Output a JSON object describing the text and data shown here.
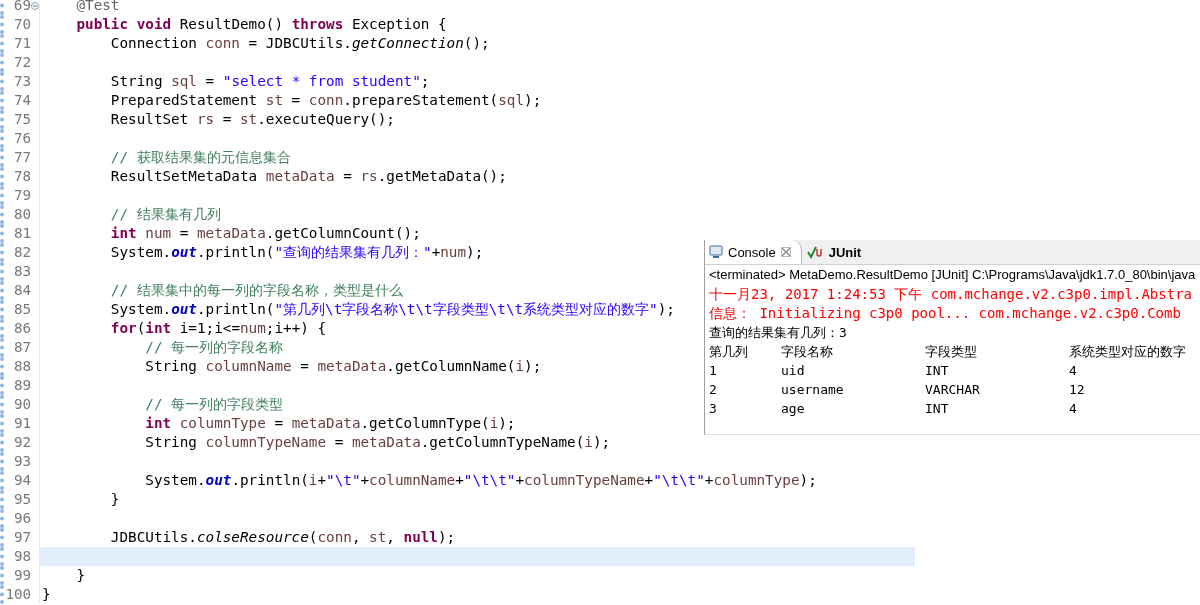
{
  "editor": {
    "lines": [
      {
        "number": "69",
        "current": false,
        "foldable": true,
        "tokens": [
          {
            "kind": "annotation",
            "text": "    @Test"
          }
        ]
      },
      {
        "number": "70",
        "current": false,
        "foldable": false,
        "tokens": [
          {
            "kind": "keyword",
            "text": "    public"
          },
          {
            "kind": "keyword",
            "text": " void"
          },
          {
            "kind": "plain",
            "text": " ResultDemo() "
          },
          {
            "kind": "keyword",
            "text": "throws"
          },
          {
            "kind": "plain",
            "text": " Exception {"
          }
        ]
      },
      {
        "number": "71",
        "current": false,
        "foldable": false,
        "tokens": [
          {
            "kind": "plain",
            "text": "        Connection "
          },
          {
            "kind": "variable",
            "text": "conn"
          },
          {
            "kind": "plain",
            "text": " = JDBCUtils."
          },
          {
            "kind": "static_method",
            "text": "getConnection"
          },
          {
            "kind": "plain",
            "text": "();"
          }
        ]
      },
      {
        "number": "72",
        "current": false,
        "foldable": false
      },
      {
        "number": "73",
        "current": false,
        "foldable": false,
        "tokens": [
          {
            "kind": "plain",
            "text": "        String "
          },
          {
            "kind": "variable",
            "text": "sql"
          },
          {
            "kind": "plain",
            "text": " = "
          },
          {
            "kind": "string",
            "text": "\"select * from student\""
          },
          {
            "kind": "plain",
            "text": ";"
          }
        ]
      },
      {
        "number": "74",
        "current": false,
        "foldable": false,
        "tokens": [
          {
            "kind": "plain",
            "text": "        PreparedStatement "
          },
          {
            "kind": "variable",
            "text": "st"
          },
          {
            "kind": "plain",
            "text": " = "
          },
          {
            "kind": "variable",
            "text": "conn"
          },
          {
            "kind": "plain",
            "text": ".prepareStatement("
          },
          {
            "kind": "variable",
            "text": "sql"
          },
          {
            "kind": "plain",
            "text": ");"
          }
        ]
      },
      {
        "number": "75",
        "current": false,
        "foldable": false,
        "tokens": [
          {
            "kind": "plain",
            "text": "        ResultSet "
          },
          {
            "kind": "variable",
            "text": "rs"
          },
          {
            "kind": "plain",
            "text": " = "
          },
          {
            "kind": "variable",
            "text": "st"
          },
          {
            "kind": "plain",
            "text": ".executeQuery();"
          }
        ]
      },
      {
        "number": "76",
        "current": false,
        "foldable": false
      },
      {
        "number": "77",
        "current": false,
        "foldable": false,
        "tokens": [
          {
            "kind": "comment",
            "text": "        // 获取结果集的元信息集合"
          }
        ]
      },
      {
        "number": "78",
        "current": false,
        "foldable": false,
        "tokens": [
          {
            "kind": "plain",
            "text": "        ResultSetMetaData "
          },
          {
            "kind": "variable",
            "text": "metaData"
          },
          {
            "kind": "plain",
            "text": " = "
          },
          {
            "kind": "variable",
            "text": "rs"
          },
          {
            "kind": "plain",
            "text": ".getMetaData();"
          }
        ]
      },
      {
        "number": "79",
        "current": false,
        "foldable": false
      },
      {
        "number": "80",
        "current": false,
        "foldable": false,
        "tokens": [
          {
            "kind": "comment",
            "text": "        // 结果集有几列"
          }
        ]
      },
      {
        "number": "81",
        "current": false,
        "foldable": false,
        "tokens": [
          {
            "kind": "keyword",
            "text": "        int"
          },
          {
            "kind": "variable",
            "text": " num"
          },
          {
            "kind": "plain",
            "text": " = "
          },
          {
            "kind": "variable",
            "text": "metaData"
          },
          {
            "kind": "plain",
            "text": ".getColumnCount();"
          }
        ]
      },
      {
        "number": "82",
        "current": false,
        "foldable": false,
        "tokens": [
          {
            "kind": "plain",
            "text": "        System."
          },
          {
            "kind": "static_field",
            "text": "out"
          },
          {
            "kind": "plain",
            "text": ".println("
          },
          {
            "kind": "string",
            "text": "\"查询的结果集有几列：\""
          },
          {
            "kind": "plain",
            "text": "+"
          },
          {
            "kind": "variable",
            "text": "num"
          },
          {
            "kind": "plain",
            "text": ");"
          }
        ]
      },
      {
        "number": "83",
        "current": false,
        "foldable": false
      },
      {
        "number": "84",
        "current": false,
        "foldable": false,
        "tokens": [
          {
            "kind": "comment",
            "text": "        // 结果集中的每一列的字段名称，类型是什么"
          }
        ]
      },
      {
        "number": "85",
        "current": false,
        "foldable": false,
        "tokens": [
          {
            "kind": "plain",
            "text": "        System."
          },
          {
            "kind": "static_field",
            "text": "out"
          },
          {
            "kind": "plain",
            "text": ".println("
          },
          {
            "kind": "string",
            "text": "\"第几列\\t字段名称\\t\\t字段类型\\t\\t系统类型对应的数字\""
          },
          {
            "kind": "plain",
            "text": ");"
          }
        ]
      },
      {
        "number": "86",
        "current": false,
        "foldable": false,
        "tokens": [
          {
            "kind": "keyword",
            "text": "        for"
          },
          {
            "kind": "plain",
            "text": "("
          },
          {
            "kind": "keyword",
            "text": "int"
          },
          {
            "kind": "plain",
            "text": " i=1;i<="
          },
          {
            "kind": "variable",
            "text": "num"
          },
          {
            "kind": "plain",
            "text": ";i++) {"
          }
        ]
      },
      {
        "number": "87",
        "current": false,
        "foldable": false,
        "tokens": [
          {
            "kind": "comment",
            "text": "            // 每一列的字段名称"
          }
        ]
      },
      {
        "number": "88",
        "current": false,
        "foldable": false,
        "tokens": [
          {
            "kind": "plain",
            "text": "            String "
          },
          {
            "kind": "variable",
            "text": "columnName"
          },
          {
            "kind": "plain",
            "text": " = "
          },
          {
            "kind": "variable",
            "text": "metaData"
          },
          {
            "kind": "plain",
            "text": ".getColumnName("
          },
          {
            "kind": "variable",
            "text": "i"
          },
          {
            "kind": "plain",
            "text": ");"
          }
        ]
      },
      {
        "number": "89",
        "current": false,
        "foldable": false
      },
      {
        "number": "90",
        "current": false,
        "foldable": false,
        "tokens": [
          {
            "kind": "comment",
            "text": "            // 每一列的字段类型"
          }
        ]
      },
      {
        "number": "91",
        "current": false,
        "foldable": false,
        "tokens": [
          {
            "kind": "keyword",
            "text": "            int"
          },
          {
            "kind": "variable",
            "text": " columnType"
          },
          {
            "kind": "plain",
            "text": " = "
          },
          {
            "kind": "variable",
            "text": "metaData"
          },
          {
            "kind": "plain",
            "text": ".getColumnType("
          },
          {
            "kind": "variable",
            "text": "i"
          },
          {
            "kind": "plain",
            "text": ");"
          }
        ]
      },
      {
        "number": "92",
        "current": false,
        "foldable": false,
        "tokens": [
          {
            "kind": "plain",
            "text": "            String "
          },
          {
            "kind": "variable",
            "text": "columnTypeName"
          },
          {
            "kind": "plain",
            "text": " = "
          },
          {
            "kind": "variable",
            "text": "metaData"
          },
          {
            "kind": "plain",
            "text": ".getColumnTypeName("
          },
          {
            "kind": "variable",
            "text": "i"
          },
          {
            "kind": "plain",
            "text": ");"
          }
        ]
      },
      {
        "number": "93",
        "current": false,
        "foldable": false
      },
      {
        "number": "94",
        "current": false,
        "foldable": false,
        "tokens": [
          {
            "kind": "plain",
            "text": "            System."
          },
          {
            "kind": "static_field",
            "text": "out"
          },
          {
            "kind": "plain",
            "text": ".println("
          },
          {
            "kind": "variable",
            "text": "i"
          },
          {
            "kind": "plain",
            "text": "+"
          },
          {
            "kind": "string",
            "text": "\"\\t\""
          },
          {
            "kind": "plain",
            "text": "+"
          },
          {
            "kind": "variable",
            "text": "columnName"
          },
          {
            "kind": "plain",
            "text": "+"
          },
          {
            "kind": "string",
            "text": "\"\\t\\t\""
          },
          {
            "kind": "plain",
            "text": "+"
          },
          {
            "kind": "variable",
            "text": "columnTypeName"
          },
          {
            "kind": "plain",
            "text": "+"
          },
          {
            "kind": "string",
            "text": "\"\\t\\t\""
          },
          {
            "kind": "plain",
            "text": "+"
          },
          {
            "kind": "variable",
            "text": "columnType"
          },
          {
            "kind": "plain",
            "text": ");"
          }
        ]
      },
      {
        "number": "95",
        "current": false,
        "foldable": false,
        "tokens": [
          {
            "kind": "plain",
            "text": "        }"
          }
        ]
      },
      {
        "number": "96",
        "current": false,
        "foldable": false
      },
      {
        "number": "97",
        "current": false,
        "foldable": false,
        "tokens": [
          {
            "kind": "plain",
            "text": "        JDBCUtils."
          },
          {
            "kind": "static_method",
            "text": "colseResource"
          },
          {
            "kind": "plain",
            "text": "("
          },
          {
            "kind": "variable",
            "text": "conn"
          },
          {
            "kind": "plain",
            "text": ", "
          },
          {
            "kind": "variable",
            "text": "st"
          },
          {
            "kind": "plain",
            "text": ", "
          },
          {
            "kind": "keyword",
            "text": "null"
          },
          {
            "kind": "plain",
            "text": ");"
          }
        ]
      },
      {
        "number": "98",
        "current": true,
        "foldable": false
      },
      {
        "number": "99",
        "current": false,
        "foldable": false,
        "tokens": [
          {
            "kind": "plain",
            "text": "    }"
          }
        ]
      },
      {
        "number": "100",
        "current": false,
        "foldable": false,
        "tokens": [
          {
            "kind": "plain",
            "text": "}"
          }
        ]
      }
    ]
  },
  "console": {
    "tabs": [
      {
        "label": "Console",
        "selected": true,
        "bold": false
      },
      {
        "label": "JUnit",
        "selected": false,
        "bold": true
      }
    ],
    "header": "<terminated> MetaDemo.ResultDemo [JUnit] C:\\Programs\\Java\\jdk1.7.0_80\\bin\\java",
    "lines": [
      {
        "kind": "error",
        "text": "十一月23, 2017 1:24:53 下午 com.mchange.v2.c3p0.impl.Abstra"
      },
      {
        "kind": "error",
        "text": "信息： Initializing c3p0 pool... com.mchange.v2.c3p0.Comb"
      },
      {
        "kind": "output",
        "text": "查询的结果集有几列：3"
      },
      {
        "kind": "output",
        "text": "第几列\t字段名称\t\t字段类型\t\t系统类型对应的数字"
      },
      {
        "kind": "output",
        "text": "1\tuid\t\tINT\t\t4"
      },
      {
        "kind": "output",
        "text": "2\tusername\t\tVARCHAR\t\t12"
      },
      {
        "kind": "output",
        "text": "3\tage\t\tINT\t\t4"
      }
    ]
  }
}
